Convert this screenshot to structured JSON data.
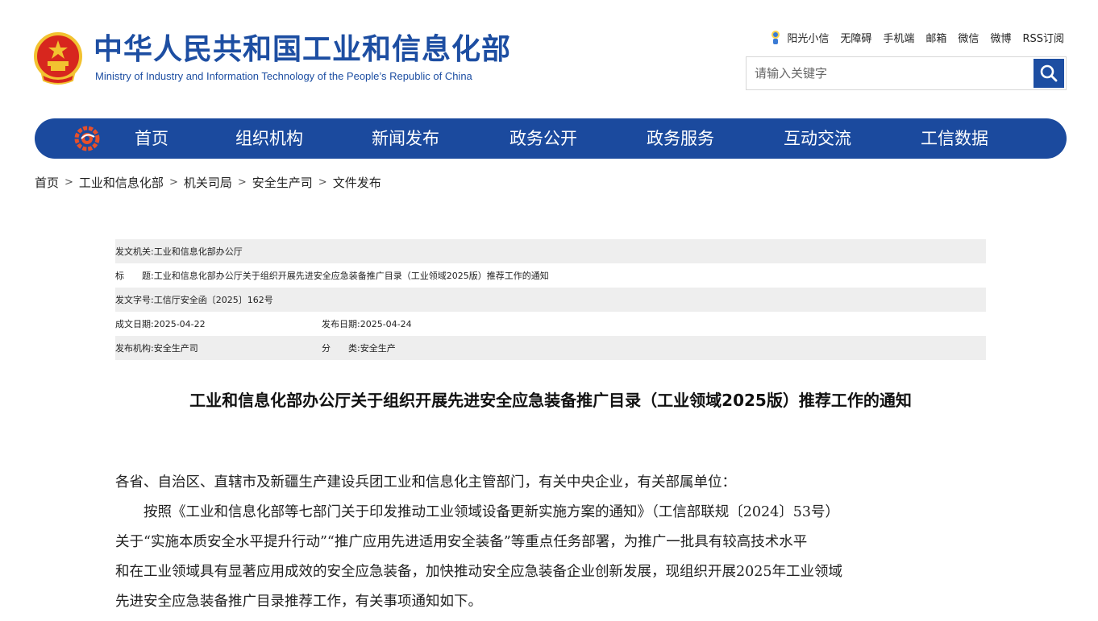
{
  "header": {
    "title_cn": "中华人民共和国工业和信息化部",
    "title_en": "Ministry of Industry and Information Technology of the People’s Republic of China"
  },
  "toplinks": [
    "阳光小信",
    "无障碍",
    "手机端",
    "邮箱",
    "微信",
    "微博",
    "RSS订阅"
  ],
  "search": {
    "placeholder": "请输入关键字"
  },
  "nav": [
    "首页",
    "组织机构",
    "新闻发布",
    "政务公开",
    "政务服务",
    "互动交流",
    "工信数据"
  ],
  "breadcrumb": [
    "首页",
    "工业和信息化部",
    "机关司局",
    "安全生产司",
    "文件发布"
  ],
  "info": {
    "issuer_label": "发文机关:",
    "issuer": "工业和信息化部办公厅",
    "title_label": "标　　题:",
    "title": "工业和信息化部办公厅关于组织开展先进安全应急装备推广目录（工业领域2025版）推荐工作的通知",
    "docno_label": "发文字号:",
    "docno": "工信厅安全函〔2025〕162号",
    "created_label": "成文日期:",
    "created": "2025-04-22",
    "published_label": "发布日期:",
    "published": "2025-04-24",
    "org_label": "发布机构:",
    "org": "安全生产司",
    "category_label": "分　　类:",
    "category": "安全生产"
  },
  "article": {
    "title": "工业和信息化部办公厅关于组织开展先进安全应急装备推广目录（工业领域2025版）推荐工作的通知",
    "salutation": "各省、自治区、直辖市及新疆生产建设兵团工业和信息化主管部门，有关中央企业，有关部属单位：",
    "lines": [
      "按照《工业和信息化部等七部门关于印发推动工业领域设备更新实施方案的通知》（工信部联规〔2024〕53号）",
      "关于“实施本质安全水平提升行动”“推广应用先进适用安全装备”等重点任务部署，为推广一批具有较高技术水平",
      "和在工业领域具有显著应用成效的安全应急装备，加快推动安全应急装备企业创新发展，现组织开展2025年工业领域",
      "先进安全应急装备推广目录推荐工作，有关事项通知如下。"
    ]
  },
  "colors": {
    "brand_blue": "#1d4ea2",
    "nav_blue": "#1b4a9e",
    "emblem_red": "#d7261e",
    "emblem_gold": "#f2c230"
  }
}
